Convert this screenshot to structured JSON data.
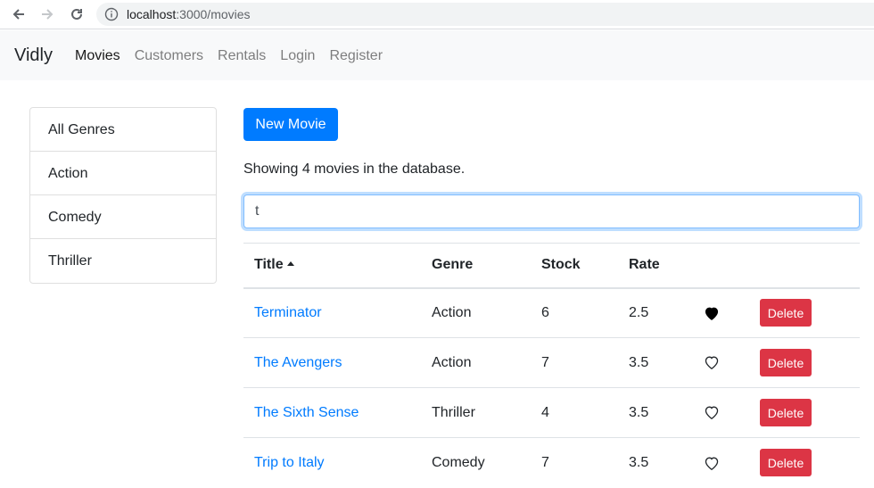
{
  "browser": {
    "url_host": "localhost",
    "url_path": ":3000/movies"
  },
  "navbar": {
    "brand": "Vidly",
    "links": [
      {
        "label": "Movies",
        "active": true
      },
      {
        "label": "Customers",
        "active": false
      },
      {
        "label": "Rentals",
        "active": false
      },
      {
        "label": "Login",
        "active": false
      },
      {
        "label": "Register",
        "active": false
      }
    ]
  },
  "genres": [
    "All Genres",
    "Action",
    "Comedy",
    "Thriller"
  ],
  "main": {
    "new_button": "New Movie",
    "count_text": "Showing 4 movies in the database.",
    "search_value": "t"
  },
  "table": {
    "headers": {
      "title": "Title",
      "genre": "Genre",
      "stock": "Stock",
      "rate": "Rate"
    },
    "rows": [
      {
        "title": "Terminator",
        "genre": "Action",
        "stock": "6",
        "rate": "2.5",
        "liked": true,
        "delete": "Delete"
      },
      {
        "title": "The Avengers",
        "genre": "Action",
        "stock": "7",
        "rate": "3.5",
        "liked": false,
        "delete": "Delete"
      },
      {
        "title": "The Sixth Sense",
        "genre": "Thriller",
        "stock": "4",
        "rate": "3.5",
        "liked": false,
        "delete": "Delete"
      },
      {
        "title": "Trip to Italy",
        "genre": "Comedy",
        "stock": "7",
        "rate": "3.5",
        "liked": false,
        "delete": "Delete"
      }
    ]
  },
  "colors": {
    "primary": "#007bff",
    "danger": "#dc3545",
    "navbar_bg": "#f8f9fa"
  }
}
